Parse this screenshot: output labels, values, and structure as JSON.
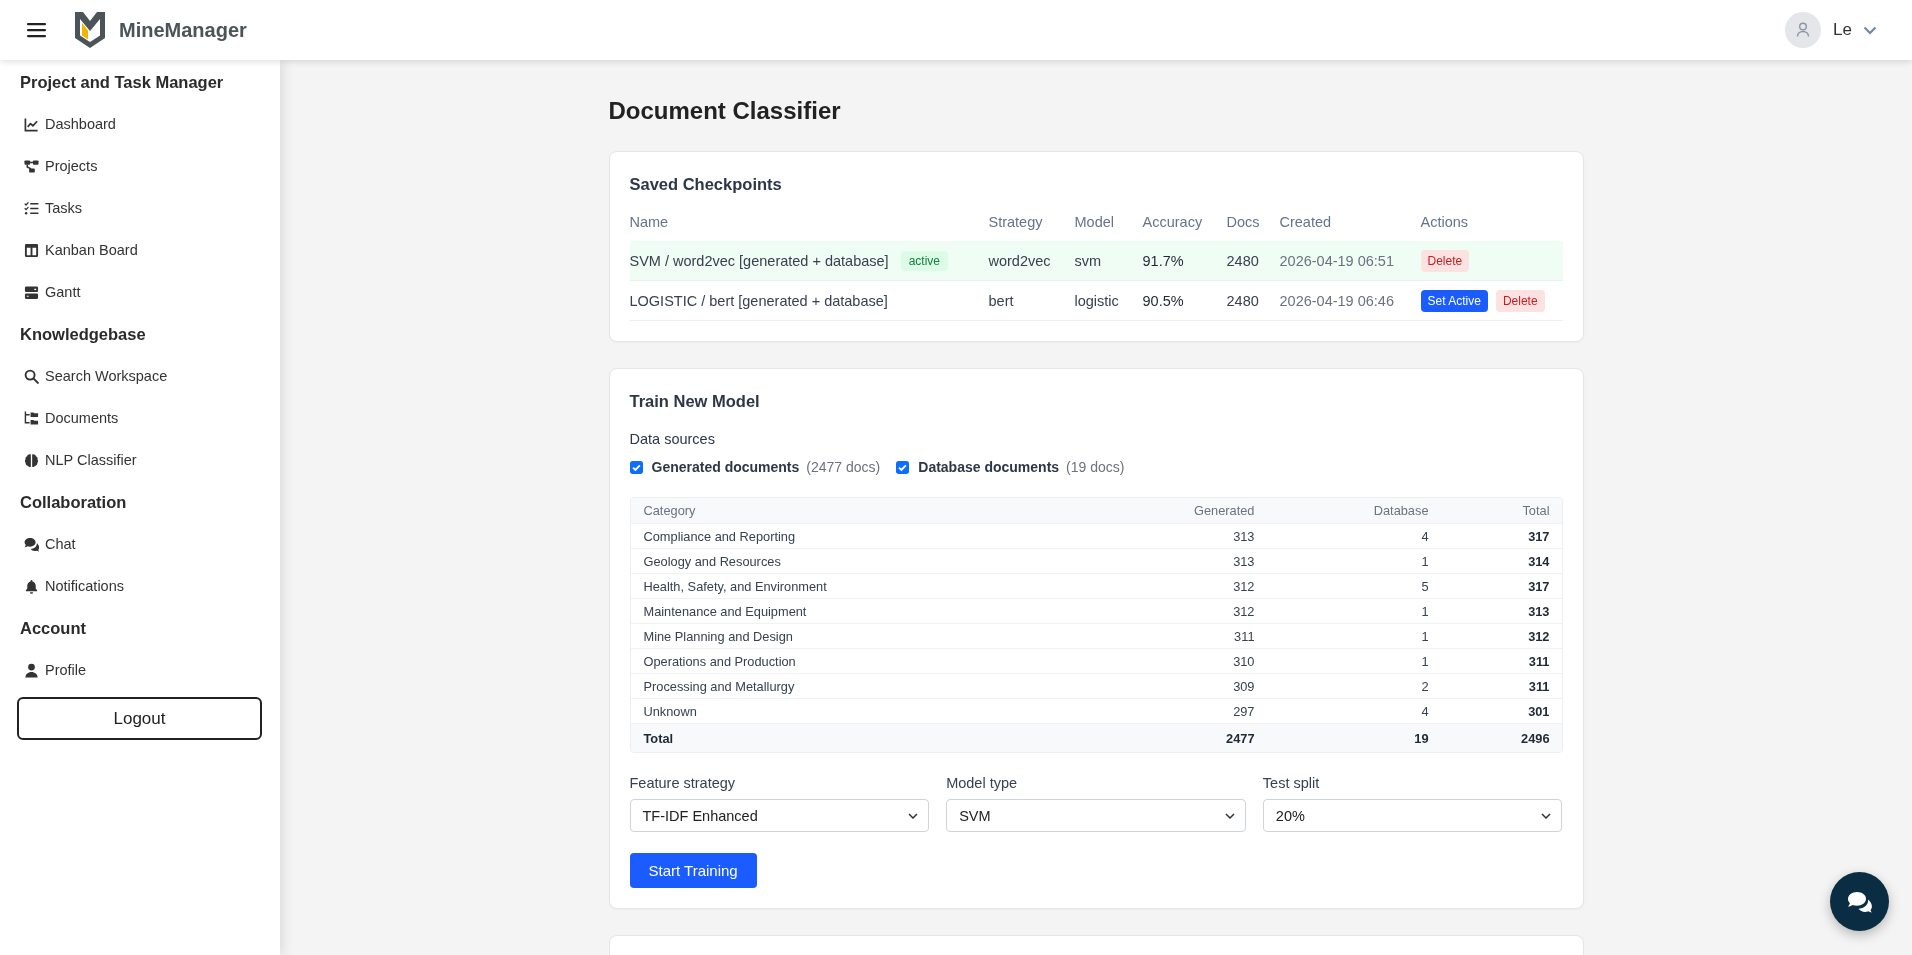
{
  "header": {
    "brand": "MineManager",
    "user": {
      "name": "Le"
    }
  },
  "sidebar": {
    "sections": [
      {
        "title": "Project and Task Manager",
        "items": [
          {
            "label": "Dashboard",
            "selected": false
          },
          {
            "label": "Projects",
            "selected": false
          },
          {
            "label": "Tasks",
            "selected": false
          },
          {
            "label": "Kanban Board",
            "selected": false
          },
          {
            "label": "Gantt",
            "selected": false
          }
        ]
      },
      {
        "title": "Knowledgebase",
        "items": [
          {
            "label": "Search Workspace",
            "selected": false
          },
          {
            "label": "Documents",
            "selected": false
          },
          {
            "label": "NLP Classifier",
            "selected": false
          }
        ]
      },
      {
        "title": "Collaboration",
        "items": [
          {
            "label": "Chat",
            "selected": false
          },
          {
            "label": "Notifications",
            "selected": false
          }
        ]
      },
      {
        "title": "Account",
        "items": [
          {
            "label": "Profile",
            "selected": false
          }
        ]
      }
    ],
    "logout": "Logout"
  },
  "page": {
    "title": "Document Classifier"
  },
  "checkpoints": {
    "title": "Saved Checkpoints",
    "columns": [
      "Name",
      "Strategy",
      "Model",
      "Accuracy",
      "Docs",
      "Created",
      "Actions"
    ],
    "rows": [
      {
        "name": "SVM / word2vec [generated + database]",
        "active": true,
        "badge": "active",
        "strategy": "word2vec",
        "model": "svm",
        "accuracy": "91.7%",
        "docs": "2480",
        "created": "2026-04-19 06:51",
        "actions": [
          {
            "kind": "delete",
            "label": "Delete"
          }
        ]
      },
      {
        "name": "LOGISTIC / bert [generated + database]",
        "active": false,
        "strategy": "bert",
        "model": "logistic",
        "accuracy": "90.5%",
        "docs": "2480",
        "created": "2026-04-19 06:46",
        "actions": [
          {
            "kind": "set_active",
            "label": "Set Active"
          },
          {
            "kind": "delete",
            "label": "Delete"
          }
        ]
      }
    ]
  },
  "train": {
    "title": "Train New Model",
    "sources_label": "Data sources",
    "sources": [
      {
        "label": "Generated documents",
        "count": "(2477 docs)",
        "checked": true
      },
      {
        "label": "Database documents",
        "count": "(19 docs)",
        "checked": true
      }
    ],
    "category_table": {
      "columns": [
        "Category",
        "Generated",
        "Database",
        "Total"
      ],
      "rows": [
        [
          "Compliance and Reporting",
          "313",
          "4",
          "317"
        ],
        [
          "Geology and Resources",
          "313",
          "1",
          "314"
        ],
        [
          "Health, Safety, and Environment",
          "312",
          "5",
          "317"
        ],
        [
          "Maintenance and Equipment",
          "312",
          "1",
          "313"
        ],
        [
          "Mine Planning and Design",
          "311",
          "1",
          "312"
        ],
        [
          "Operations and Production",
          "310",
          "1",
          "311"
        ],
        [
          "Processing and Metallurgy",
          "309",
          "2",
          "311"
        ],
        [
          "Unknown",
          "297",
          "4",
          "301"
        ]
      ],
      "total": [
        "Total",
        "2477",
        "19",
        "2496"
      ]
    },
    "fields": [
      {
        "label": "Feature strategy",
        "value": "TF-IDF Enhanced"
      },
      {
        "label": "Model type",
        "value": "SVM"
      },
      {
        "label": "Test split",
        "value": "20%"
      }
    ],
    "submit": "Start Training"
  }
}
